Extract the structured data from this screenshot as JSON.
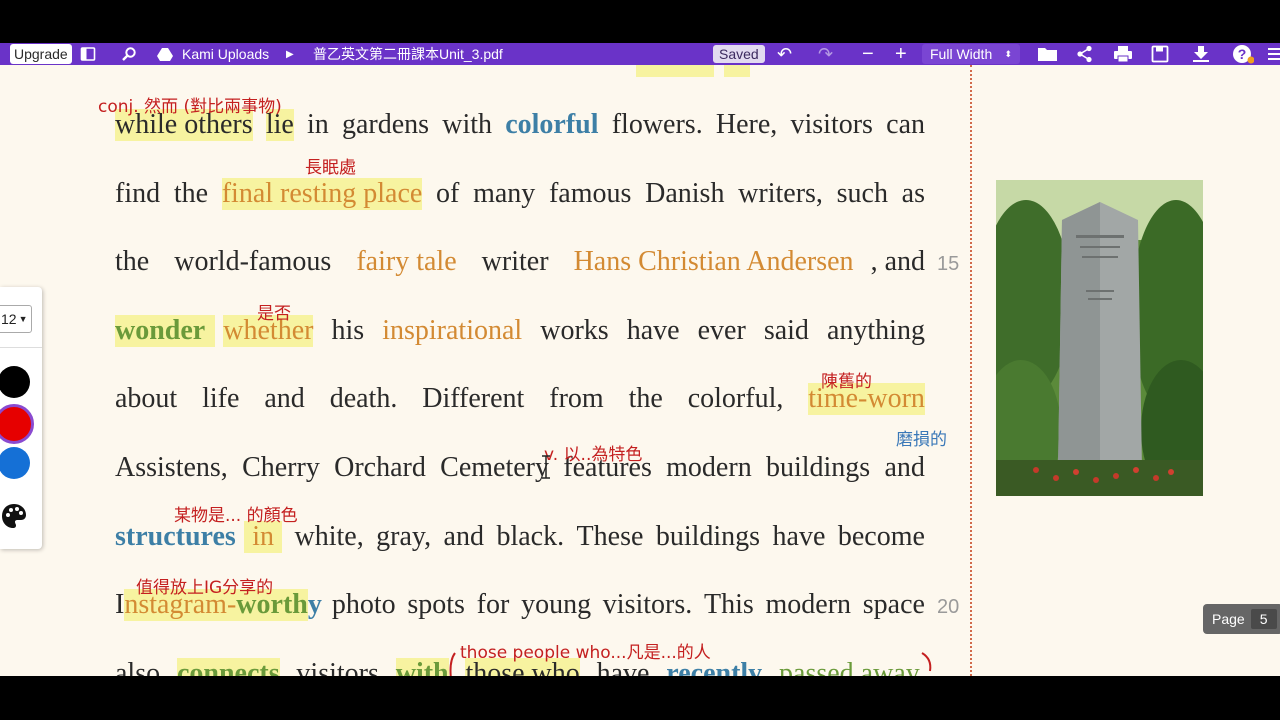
{
  "toolbar": {
    "upgrade_label": "Upgrade",
    "breadcrumb_root": "Kami Uploads",
    "file_name": "普乙英文第二冊課本Unit_3.pdf",
    "saved_label": "Saved",
    "zoom_value": "Full Width",
    "icons": [
      "sidebar-icon",
      "search-icon",
      "drive-icon",
      "chevron-right-icon",
      "undo-icon",
      "redo-icon",
      "zoom-out-icon",
      "zoom-in-icon",
      "folder-icon",
      "share-icon",
      "print-icon",
      "save-icon",
      "download-icon",
      "help-icon",
      "menu-icon"
    ]
  },
  "left_panel": {
    "font_size": "12",
    "colors": [
      "#000000",
      "#e60000",
      "#1570d6"
    ],
    "palette_icon": "palette-icon"
  },
  "lines": [
    {
      "words": [
        "while others",
        "lie",
        "in",
        "gardens",
        "with",
        "colorful",
        "flowers.",
        "Here,",
        "visitors",
        "can"
      ]
    },
    {
      "words": [
        "find",
        "the",
        "final resting place",
        "of",
        "many",
        "famous",
        "Danish",
        "writers,",
        "such",
        "as"
      ]
    },
    {
      "words": [
        "the",
        "world-famous",
        "fairy tale",
        "writer",
        "Hans Christian Andersen",
        ", and"
      ]
    },
    {
      "words": [
        "wonder",
        "whether",
        "his",
        "inspirational",
        "works",
        "have",
        "ever",
        "said",
        "anything"
      ]
    },
    {
      "words": [
        "about",
        "life",
        "and",
        "death.",
        "Different",
        "from",
        "the",
        "colorful,",
        "time-worn"
      ]
    },
    {
      "words": [
        "Assistens,",
        "Cherry",
        "Orchard",
        "Cemetery",
        "features",
        "modern",
        "buildings",
        "and"
      ]
    },
    {
      "words": [
        "structures",
        "in",
        "white,",
        "gray,",
        "and",
        "black.",
        "These",
        "buildings",
        "have",
        "become"
      ]
    },
    {
      "words": [
        "I",
        "nstagram-",
        "worth",
        "y",
        "photo",
        "spots",
        "for",
        "young",
        "visitors.",
        "This",
        "modern",
        "space"
      ]
    },
    {
      "words": [
        "also",
        "connects",
        "visitors",
        "with",
        "those who",
        "have",
        "recently",
        "passed away."
      ]
    }
  ],
  "notes": {
    "n1": "conj. 然而 (對比兩事物)",
    "n2": "長眠處",
    "n3": "是否",
    "n4": "陳舊的",
    "n5": "磨損的",
    "n6": "v. 以..為特色",
    "n7": "某物是... 的顏色",
    "n8": "值得放上IG分享的",
    "n9": "those people who...凡是...的人"
  },
  "line_numbers": [
    "15",
    "20"
  ],
  "page_indicator": {
    "label": "Page",
    "number": "5"
  }
}
